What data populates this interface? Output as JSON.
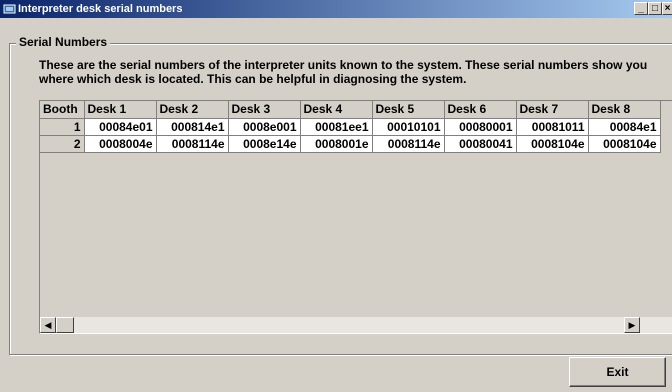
{
  "window": {
    "title": "Interpreter desk serial numbers",
    "minimize_label": "_",
    "maximize_label": "□",
    "close_label": "×"
  },
  "group": {
    "label": "Serial Numbers",
    "description": "These are the serial numbers of the interpreter units known to the system. These serial numbers show you where which desk is located. This can be helpful in diagnosing the system."
  },
  "grid": {
    "headers": [
      "Booth",
      "Desk 1",
      "Desk 2",
      "Desk 3",
      "Desk 4",
      "Desk 5",
      "Desk 6",
      "Desk 7",
      "Desk 8"
    ],
    "rows": [
      [
        "1",
        "00084e01",
        "000814e1",
        "0008e001",
        "00081ee1",
        "00010101",
        "00080001",
        "00081011",
        "00084e1"
      ],
      [
        "2",
        "0008004e",
        "0008114e",
        "0008e14e",
        "0008001e",
        "0008114e",
        "00080041",
        "0008104e",
        "0008104e"
      ]
    ]
  },
  "scrollbar": {
    "left_arrow": "◀",
    "right_arrow": "▶"
  },
  "buttons": {
    "exit_label": "Exit"
  }
}
